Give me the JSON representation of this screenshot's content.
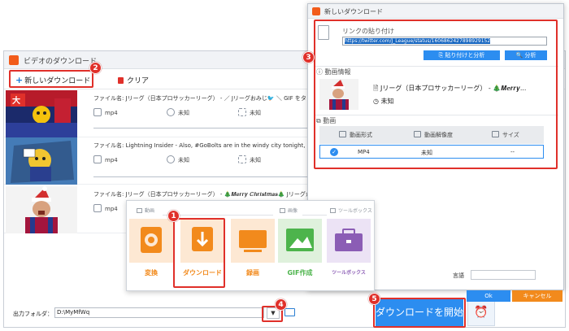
{
  "main_window": {
    "title": "ビデオのダウンロード",
    "toolbar": {
      "new_download": "新しいダウンロード",
      "clear": "クリア"
    },
    "rows": [
      {
        "filename": "ファイル名: Jリーグ（日本プロサッカーリーグ） - ／ Jリーグおみじ🐦 ＼ GIF をタップして 2023年の運",
        "format": "mp4",
        "resolution": "未知",
        "size": "未知",
        "thumb": "red-blue crowd"
      },
      {
        "filename": "ファイル名: Lightning Insider - Also, #GoBolts are in the windy city tonight, need an excuse t",
        "format": "mp4",
        "resolution": "未知",
        "size": "未知",
        "thumb": "cartoon with sign"
      },
      {
        "filename": "ファイル名: Jリーグ（日本プロサッカーリーグ） - 🎄𝑴𝒆𝒓𝒓𝒚 𝑪𝒉𝒓𝒊𝒔𝒕𝒎𝒂𝒔🎄 Jリーグからクリスマスプレゼン",
        "format": "mp4",
        "resolution": "",
        "size": "",
        "thumb": "santa player"
      }
    ]
  },
  "bottom_bar": {
    "output_label": "出力フォルダ：",
    "output_path": "D:\\MyMfWq",
    "start_button": "ダウンロードを開始",
    "alarm_icon": "alarm-icon"
  },
  "popup": {
    "title": "新しいダウンロード",
    "link_label": "リンクの貼り付け",
    "link_value": "https://twitter.com/J_League/status/1606862427898929152",
    "paste_analyze": "貼り付けと分析",
    "analyze": "分析",
    "video_info_label": "動画情報",
    "video_title": "Jリーグ（日本プロサッカーリーグ） - 🎄𝑴𝒆𝒓𝒓𝒚...",
    "video_duration": "未知",
    "video_section": "動画",
    "columns": [
      "動画形式",
      "動画解像度",
      "サイズ"
    ],
    "format_row": {
      "format": "MP4",
      "resolution": "未知",
      "size": "--"
    },
    "language_label": "言語",
    "ok": "Ok",
    "cancel": "キャンセル"
  },
  "toolbox": {
    "categories": [
      "動画",
      "画像",
      "ツールボックス"
    ],
    "tools": [
      {
        "label": "変換",
        "color": "#f28a1c"
      },
      {
        "label": "ダウンロード",
        "color": "#f28a1c"
      },
      {
        "label": "録画",
        "color": "#f28a1c"
      },
      {
        "label": "GIF作成",
        "color": "#4db44c"
      },
      {
        "label": "ツールボックス",
        "color": "#8b5db5"
      }
    ]
  },
  "badges": [
    "1",
    "2",
    "3",
    "4",
    "5"
  ],
  "colors": {
    "accent": "#2c8df0",
    "highlight": "#e0302a",
    "orange": "#f28a1c"
  }
}
